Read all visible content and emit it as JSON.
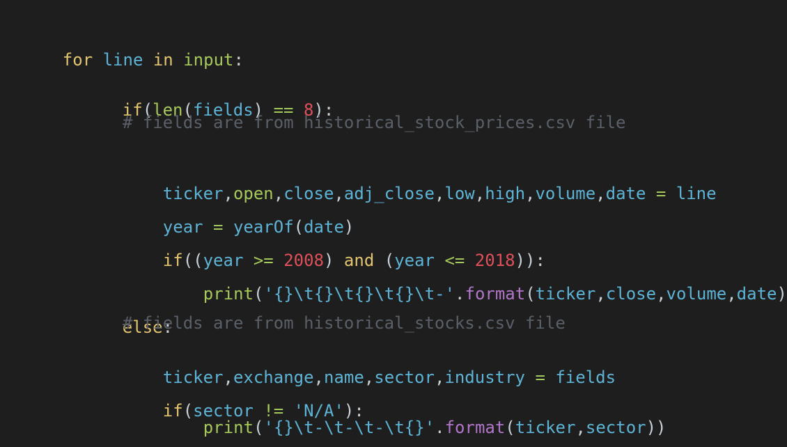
{
  "code": {
    "l1": [
      "for",
      " ",
      "line",
      " ",
      "in",
      " ",
      "input",
      ":"
    ],
    "l2": [
      "if",
      "(",
      "len",
      "(",
      "fields",
      ")",
      " ",
      "==",
      " ",
      "8",
      "):"
    ],
    "l3": "# fields are from historical_stock_prices.csv file",
    "l4": [
      "ticker",
      ",",
      "open",
      ",",
      "close",
      ",",
      "adj_close",
      ",",
      "low",
      ",",
      "high",
      ",",
      "volume",
      ",",
      "date",
      " ",
      "=",
      " ",
      "line"
    ],
    "l5": [
      "year",
      " ",
      "=",
      " ",
      "yearOf",
      "(",
      "date",
      ")"
    ],
    "l6": [
      "if",
      "((",
      "year",
      " ",
      ">=",
      " ",
      "2008",
      ")",
      " ",
      "and",
      " ",
      "(",
      "year",
      " ",
      "<=",
      " ",
      "2018",
      ")):"
    ],
    "l7": [
      "print",
      "(",
      "'{}\\t{}\\t{}\\t{}\\t-'",
      ".",
      "format",
      "(",
      "ticker",
      ",",
      "close",
      ",",
      "volume",
      ",",
      "date",
      "))"
    ],
    "l8": [
      "else",
      ":"
    ],
    "l9": "# fields are from historical_stocks.csv file",
    "l10": [
      "ticker",
      ",",
      "exchange",
      ",",
      "name",
      ",",
      "sector",
      ",",
      "industry",
      " ",
      "=",
      " ",
      "fields"
    ],
    "l11": [
      "if",
      "(",
      "sector",
      " ",
      "!=",
      " ",
      "'N/A'",
      "):"
    ],
    "l12": [
      "print",
      "(",
      "'{}\\t-\\t-\\t-\\t{}'",
      ".",
      "format",
      "(",
      "ticker",
      ",",
      "sector",
      "))"
    ]
  }
}
